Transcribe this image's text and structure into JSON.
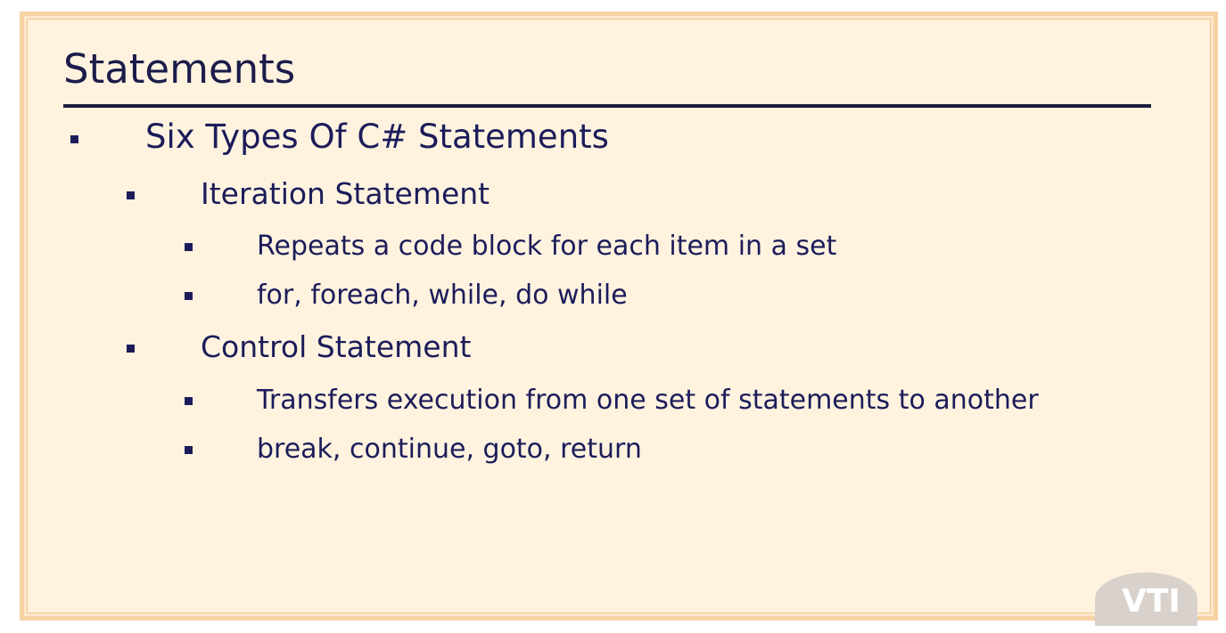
{
  "slide": {
    "title": "Statements",
    "items": [
      {
        "text": "Six Types Of C# Statements"
      },
      {
        "text": "Iteration Statement"
      },
      {
        "text": "Repeats a code block for each item in a set"
      },
      {
        "text": "for, foreach, while, do while"
      },
      {
        "text": "Control Statement"
      },
      {
        "text": "Transfers execution from one set of statements to another"
      },
      {
        "text": "break, continue, goto, return"
      }
    ]
  },
  "watermark": {
    "text": "VTI"
  },
  "colors": {
    "slide_background": "#fff3df",
    "slide_border": "#f7d2a3",
    "text": "#1c1c5a",
    "title_rule": "#1c1c3c"
  }
}
